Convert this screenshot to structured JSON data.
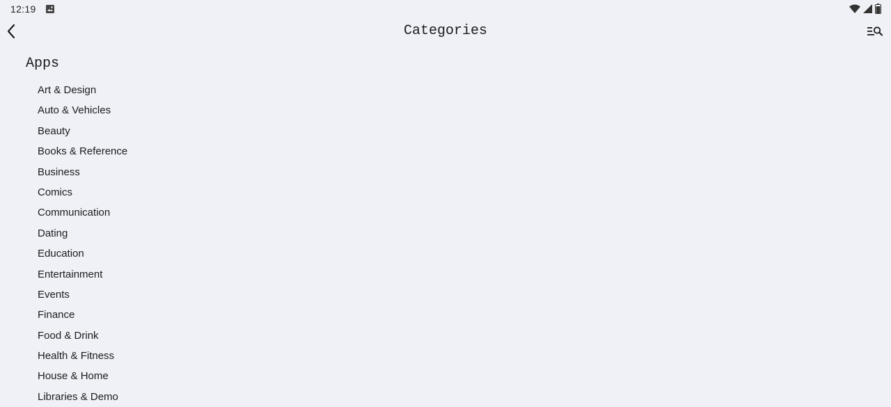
{
  "status_bar": {
    "time": "12:19",
    "icons": [
      "photo-icon",
      "wifi-icon",
      "cell-signal-icon",
      "battery-icon"
    ]
  },
  "toolbar": {
    "back_icon": "chevron-left-icon",
    "title": "Categories",
    "search_icon": "filter-search-icon"
  },
  "section": {
    "title": "Apps"
  },
  "categories": [
    "Art & Design",
    "Auto & Vehicles",
    "Beauty",
    "Books & Reference",
    "Business",
    "Comics",
    "Communication",
    "Dating",
    "Education",
    "Entertainment",
    "Events",
    "Finance",
    "Food & Drink",
    "Health & Fitness",
    "House & Home",
    "Libraries & Demo"
  ],
  "colors": {
    "background": "#f0f1f6",
    "text": "#1b1b1f"
  }
}
